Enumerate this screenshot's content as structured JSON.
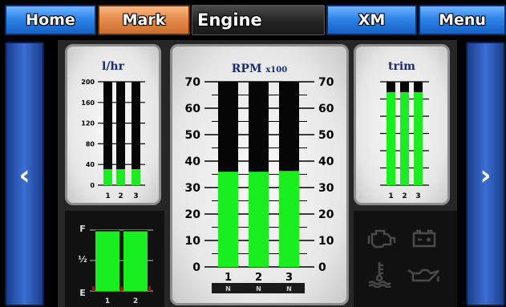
{
  "tabs": {
    "home": "Home",
    "mark": "Mark",
    "title": "Engine",
    "xm": "XM",
    "menu": "Menu"
  },
  "nav": {
    "prev_glyph": "‹",
    "next_glyph": "›"
  },
  "fuel_rate": {
    "title": "l/hr",
    "ticks": [
      "200",
      "160",
      "120",
      "80",
      "40",
      "0"
    ],
    "max": 200,
    "engines": [
      "1",
      "2",
      "3"
    ],
    "values": [
      31,
      31,
      31
    ]
  },
  "rpm": {
    "title": "RPM",
    "title_unit": "x100",
    "ticks": [
      "70",
      "60",
      "50",
      "40",
      "30",
      "20",
      "10",
      "0"
    ],
    "max": 70,
    "engines": [
      "1",
      "2",
      "3"
    ],
    "values": [
      36,
      36,
      36.3
    ],
    "gear": [
      "N",
      "N",
      "N"
    ]
  },
  "trim": {
    "title": "trim",
    "engines": [
      "1",
      "2",
      "3"
    ],
    "values": [
      0.9,
      0.9,
      0.9
    ]
  },
  "fuel_level": {
    "full_label": "F",
    "half_label": "½",
    "empty_label": "E",
    "tanks": [
      "1",
      "2"
    ],
    "values": [
      0.98,
      0.98
    ]
  },
  "warnings": {
    "icons": [
      "check-engine-icon",
      "battery-icon",
      "coolant-temperature-icon",
      "oil-pressure-icon"
    ]
  },
  "colors": {
    "bar_fill": "#19ef1f",
    "bar_empty": "#050505",
    "tab_blue": "#2f84e8",
    "tab_orange": "#e58e4d"
  }
}
